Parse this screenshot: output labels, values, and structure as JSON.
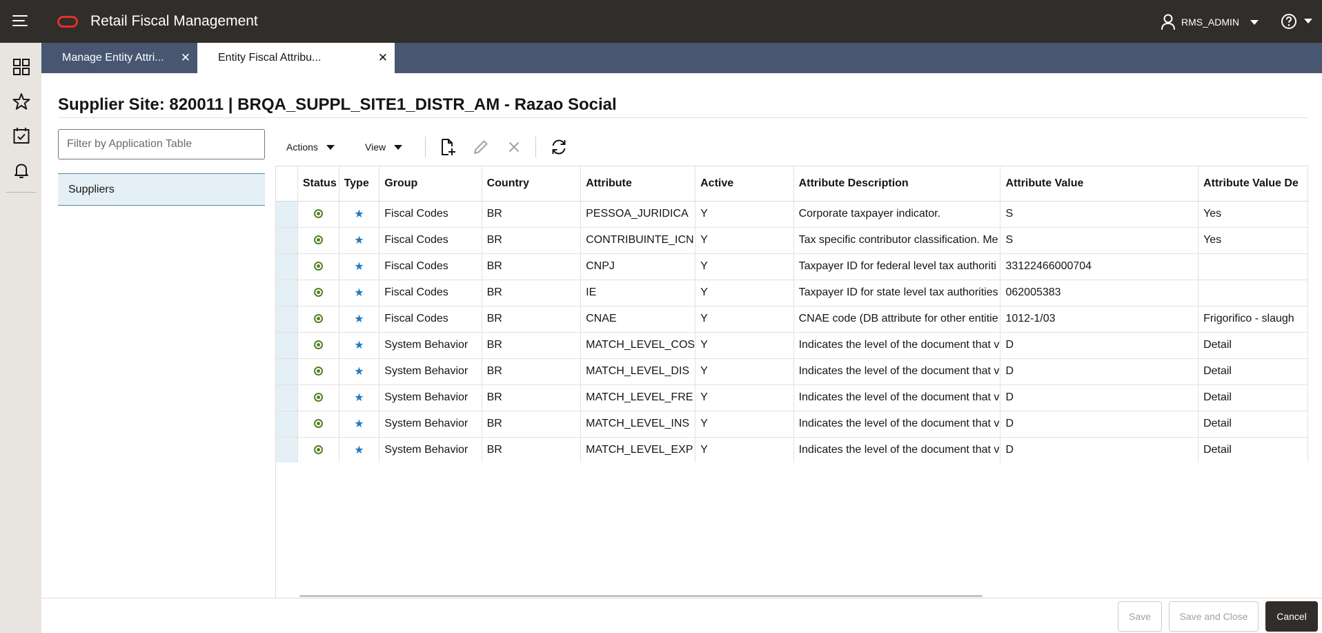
{
  "header": {
    "app_title": "Retail Fiscal Management",
    "user_name": "RMS_ADMIN",
    "icons": [
      "hamburger-menu-icon",
      "oracle-logo-icon",
      "user-icon",
      "help-icon"
    ]
  },
  "rail": {
    "icons": [
      "dashboard-icon",
      "favorites-star-icon",
      "tasks-calendar-icon",
      "notifications-bell-icon"
    ]
  },
  "tabs": [
    {
      "label": "Manage Entity Attri...",
      "active": false
    },
    {
      "label": "Entity Fiscal Attribu...",
      "active": true
    }
  ],
  "page": {
    "title": "Supplier Site: 820011 | BRQA_SUPPL_SITE1_DISTR_AM - Razao Social"
  },
  "left_panel": {
    "filter_placeholder": "Filter by Application Table",
    "items": [
      "Suppliers"
    ]
  },
  "toolbar": {
    "actions_label": "Actions",
    "view_label": "View",
    "icons": [
      "add-document-icon",
      "edit-pencil-icon",
      "delete-x-icon",
      "refresh-icon"
    ]
  },
  "table": {
    "columns": [
      "Status",
      "Type",
      "Group",
      "Country",
      "Attribute",
      "Active",
      "Attribute Description",
      "Attribute Value",
      "Attribute Value De"
    ],
    "rows": [
      {
        "group": "Fiscal Codes",
        "country": "BR",
        "attribute": "PESSOA_JURIDICA",
        "active": "Y",
        "description": "Corporate taxpayer indicator.",
        "value": "S",
        "value_desc": "Yes"
      },
      {
        "group": "Fiscal Codes",
        "country": "BR",
        "attribute": "CONTRIBUINTE_ICN",
        "active": "Y",
        "description": "Tax specific contributor classification. Me",
        "value": "S",
        "value_desc": "Yes"
      },
      {
        "group": "Fiscal Codes",
        "country": "BR",
        "attribute": "CNPJ",
        "active": "Y",
        "description": "Taxpayer ID for federal level tax authoriti",
        "value": "33122466000704",
        "value_desc": ""
      },
      {
        "group": "Fiscal Codes",
        "country": "BR",
        "attribute": "IE",
        "active": "Y",
        "description": "Taxpayer ID for state level tax authorities",
        "value": "062005383",
        "value_desc": ""
      },
      {
        "group": "Fiscal Codes",
        "country": "BR",
        "attribute": "CNAE",
        "active": "Y",
        "description": "CNAE code (DB attribute for other entitie",
        "value": "1012-1/03",
        "value_desc": "Frigorifico - slaugh"
      },
      {
        "group": "System Behavior",
        "country": "BR",
        "attribute": "MATCH_LEVEL_COS",
        "active": "Y",
        "description": "Indicates the level of the document that v",
        "value": "D",
        "value_desc": "Detail"
      },
      {
        "group": "System Behavior",
        "country": "BR",
        "attribute": "MATCH_LEVEL_DIS",
        "active": "Y",
        "description": "Indicates the level of the document that v",
        "value": "D",
        "value_desc": "Detail"
      },
      {
        "group": "System Behavior",
        "country": "BR",
        "attribute": "MATCH_LEVEL_FRE",
        "active": "Y",
        "description": "Indicates the level of the document that v",
        "value": "D",
        "value_desc": "Detail"
      },
      {
        "group": "System Behavior",
        "country": "BR",
        "attribute": "MATCH_LEVEL_INS",
        "active": "Y",
        "description": "Indicates the level of the document that v",
        "value": "D",
        "value_desc": "Detail"
      },
      {
        "group": "System Behavior",
        "country": "BR",
        "attribute": "MATCH_LEVEL_EXP",
        "active": "Y",
        "description": "Indicates the level of the document that v",
        "value": "D",
        "value_desc": "Detail"
      }
    ]
  },
  "footer": {
    "save_label": "Save",
    "save_close_label": "Save and Close",
    "cancel_label": "Cancel"
  },
  "colors": {
    "header_bg": "#312d2a",
    "tabs_bg": "#485671",
    "rail_bg": "#e8e5e1",
    "oracle_red": "#e5312a",
    "status_green": "#508223",
    "type_star_blue": "#227abf",
    "selection_bg": "#e4f0f6"
  }
}
